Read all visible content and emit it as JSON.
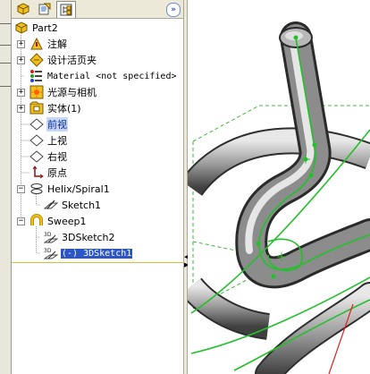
{
  "tabs": [
    {
      "name": "feature-manager",
      "icon": "feature-manager-icon"
    },
    {
      "name": "property-manager",
      "icon": "property-manager-icon"
    },
    {
      "name": "configuration-manager",
      "icon": "configuration-manager-icon"
    }
  ],
  "collapse_label": "»",
  "tree": {
    "root": "Part2",
    "items": [
      {
        "label": "注解",
        "icon": "annotations-icon",
        "expandable": true
      },
      {
        "label": "设计活页夹",
        "icon": "design-binder-icon",
        "expandable": true
      },
      {
        "label": "Material <not specified>",
        "icon": "material-icon",
        "expandable": false
      },
      {
        "label": "光源与相机",
        "icon": "lights-cameras-icon",
        "expandable": true
      },
      {
        "label": "实体(1)",
        "icon": "solid-bodies-icon",
        "expandable": true
      },
      {
        "label": "前视",
        "icon": "plane-icon",
        "expandable": false
      },
      {
        "label": "上视",
        "icon": "plane-icon",
        "expandable": false
      },
      {
        "label": "右视",
        "icon": "plane-icon",
        "expandable": false
      },
      {
        "label": "原点",
        "icon": "origin-icon",
        "expandable": false
      },
      {
        "label": "Helix/Spiral1",
        "icon": "helix-icon",
        "expandable": true,
        "expanded": true
      },
      {
        "label": "Sketch1",
        "icon": "sketch-icon",
        "child": true
      },
      {
        "label": "Sweep1",
        "icon": "sweep-icon",
        "expandable": true,
        "expanded": true
      },
      {
        "label": "3DSketch2",
        "icon": "3dsketch-icon",
        "child": true
      },
      {
        "label": "(-) 3DSketch1",
        "icon": "3dsketch-icon",
        "child": true,
        "selected": true
      }
    ]
  },
  "sketch_icon_text": "3D",
  "colors": {
    "selection": "#2c55c6",
    "sketch_line": "#22c02a",
    "reference_plane": "#3cb83c",
    "axis": "#e02020"
  }
}
